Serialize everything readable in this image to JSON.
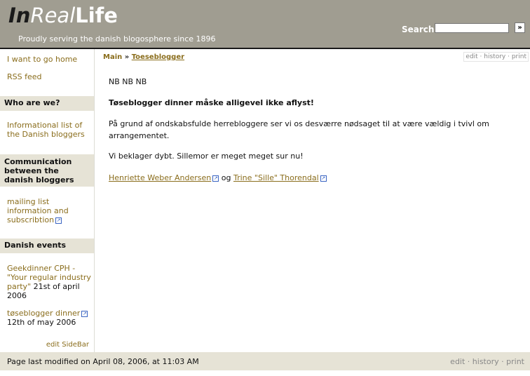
{
  "header": {
    "logo_part1": "In",
    "logo_part2": "Real",
    "logo_part3": "Life",
    "tagline": "Proudly serving the danish blogosphere since 1896",
    "search_label": "Search",
    "search_value": "",
    "search_go": "»"
  },
  "sidebar": {
    "links": [
      {
        "label": "I want to go home"
      },
      {
        "label": "RSS feed"
      }
    ],
    "sections": [
      {
        "heading": "Who are we?",
        "item": "Informational list of the Danish bloggers"
      },
      {
        "heading": "Communication between the danish bloggers",
        "item": "mailing list information and subscribtion"
      },
      {
        "heading": "Danish events",
        "event1_link": "Geekdinner CPH - \"Your regular industry party\"",
        "event1_date": " 21st of april 2006",
        "event2_link": "tøseblogger dinner",
        "event2_date": "12th of may 2006"
      }
    ],
    "edit_label": "edit SideBar"
  },
  "main": {
    "breadcrumb_main": "Main",
    "breadcrumb_sep": " » ",
    "breadcrumb_page": "Toeseblogger",
    "actions": {
      "edit": "edit",
      "history": "history",
      "print": "print",
      "sep": " · "
    },
    "p1": "NB NB NB",
    "p2": "Tøseblogger dinner måske alligevel ikke aflyst!",
    "p3": "På grund af ondskabsfulde herrebloggere ser vi os desværre nødsaget til at være vældig i tvivl om arrangementet.",
    "p4": "Vi beklager dybt. Sillemor er meget meget sur nu!",
    "author1": "Henriette Weber Andersen",
    "og": " og ",
    "author2": "Trine \"Sille\" Thorendal"
  },
  "footer": {
    "modified": "Page last modified on April 08, 2006, at 11:03 AM",
    "edit": "edit",
    "history": "history",
    "print": "print",
    "sep": " · "
  },
  "colors": {
    "header_bg": "#a09d91",
    "link": "#8a6d1c",
    "sidebar_heading_bg": "#e6e3d6"
  }
}
